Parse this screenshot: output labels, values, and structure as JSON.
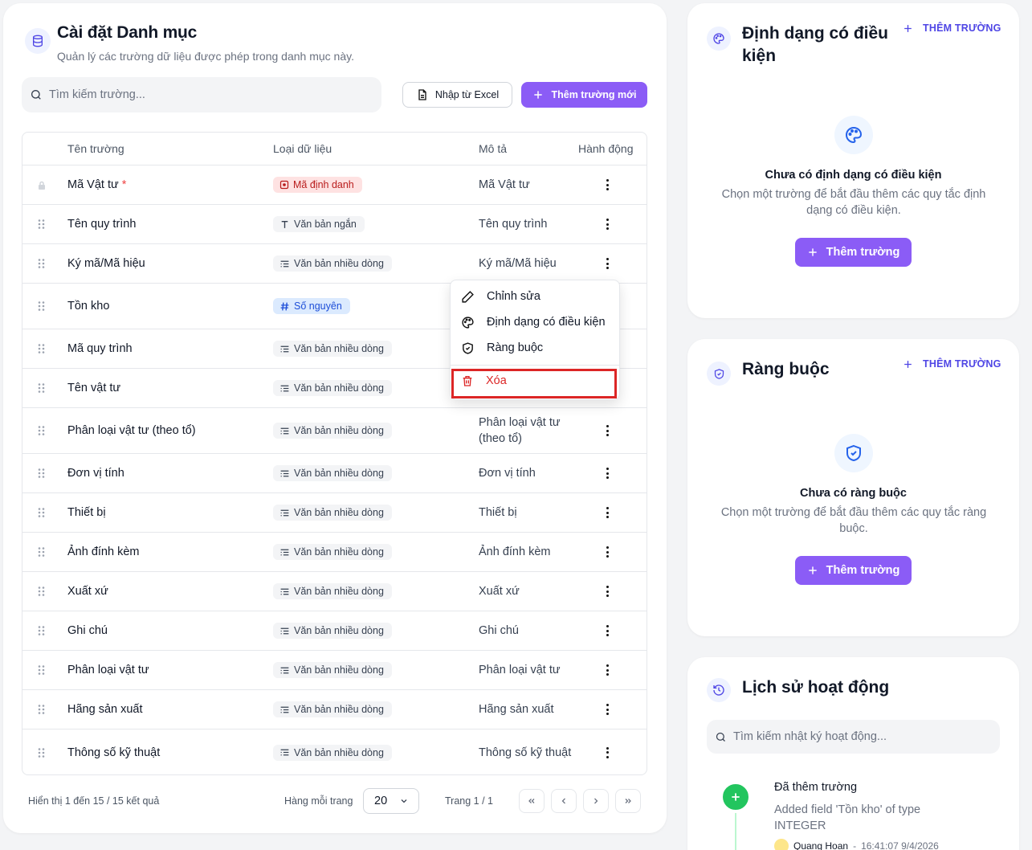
{
  "main": {
    "title": "Cài đặt Danh mục",
    "subtitle": "Quản lý các trường dữ liệu được phép trong danh mục này.",
    "search_placeholder": "Tìm kiếm trường...",
    "import_label": "Nhập từ Excel",
    "add_field_label": "Thêm trường mới",
    "columns": [
      "Tên trường",
      "Loại dữ liệu",
      "Mô tả",
      "Hành động"
    ],
    "rows": [
      {
        "name": "Mã Vật tư",
        "required": "*",
        "type": "Mã định danh",
        "type_icon": "id-badge-icon",
        "desc": "Mã Vật tư",
        "locked": true
      },
      {
        "name": "Tên quy trình",
        "type": "Văn bản ngắn",
        "type_icon": "text-icon",
        "desc": "Tên quy trình"
      },
      {
        "name": "Ký mã/Mã hiệu",
        "type": "Văn bản nhiều dòng",
        "type_icon": "multiline-icon",
        "desc": "Ký mã/Mã hiệu"
      },
      {
        "name": "Tồn kho",
        "type": "Số nguyên",
        "type_icon": "hash-icon",
        "desc": ""
      },
      {
        "name": "Mã quy trình",
        "type": "Văn bản nhiều dòng",
        "type_icon": "multiline-icon",
        "desc": ""
      },
      {
        "name": "Tên vật tư",
        "type": "Văn bản nhiều dòng",
        "type_icon": "multiline-icon",
        "desc": ""
      },
      {
        "name": "Phân loại vật tư (theo tổ)",
        "type": "Văn bản nhiều dòng",
        "type_icon": "multiline-icon",
        "desc": "Phân loại vật tư (theo tổ)"
      },
      {
        "name": "Đơn vị tính",
        "type": "Văn bản nhiều dòng",
        "type_icon": "multiline-icon",
        "desc": "Đơn vị tính"
      },
      {
        "name": "Thiết bị",
        "type": "Văn bản nhiều dòng",
        "type_icon": "multiline-icon",
        "desc": "Thiết bị"
      },
      {
        "name": "Ảnh đính kèm",
        "type": "Văn bản nhiều dòng",
        "type_icon": "multiline-icon",
        "desc": "Ảnh đính kèm"
      },
      {
        "name": "Xuất xứ",
        "type": "Văn bản nhiều dòng",
        "type_icon": "multiline-icon",
        "desc": "Xuất xứ"
      },
      {
        "name": "Ghi chú",
        "type": "Văn bản nhiều dòng",
        "type_icon": "multiline-icon",
        "desc": "Ghi chú"
      },
      {
        "name": "Phân loại vật tư",
        "type": "Văn bản nhiều dòng",
        "type_icon": "multiline-icon",
        "desc": "Phân loại vật tư"
      },
      {
        "name": "Hãng sản xuất",
        "type": "Văn bản nhiều dòng",
        "type_icon": "multiline-icon",
        "desc": "Hãng sản xuất"
      },
      {
        "name": "Thông số kỹ thuật",
        "type": "Văn bản nhiều dòng",
        "type_icon": "multiline-icon",
        "desc": "Thông số kỹ thuật"
      }
    ],
    "footer": {
      "showing": "Hiển thị 1 đến 15 / 15 kết quả",
      "rows_per_page_label": "Hàng mỗi trang",
      "rows_per_page": "20",
      "page_info": "Trang 1 / 1"
    }
  },
  "context_menu": {
    "items": [
      {
        "label": "Chỉnh sửa",
        "icon": "pencil-icon"
      },
      {
        "label": "Định dạng có điều kiện",
        "icon": "palette-icon"
      },
      {
        "label": "Ràng buộc",
        "icon": "shield-icon"
      },
      {
        "label": "Xóa",
        "icon": "trash-icon"
      }
    ]
  },
  "conditional_format": {
    "title": "Định dạng có điều kiện",
    "add_link": "THÊM TRƯỜNG",
    "empty_title": "Chưa có định dạng có điều kiện",
    "empty_desc": "Chọn một trường để bắt đầu thêm các quy tắc định dạng có điều kiện.",
    "button": "Thêm trường"
  },
  "constraints": {
    "title": "Ràng buộc",
    "add_link": "THÊM TRƯỜNG",
    "empty_title": "Chưa có ràng buộc",
    "empty_desc": "Chọn một trường để bắt đầu thêm các quy tắc ràng buộc.",
    "button": "Thêm trường"
  },
  "activity": {
    "title": "Lịch sử hoạt động",
    "search_placeholder": "Tìm kiếm nhật ký hoạt động...",
    "entry": {
      "title": "Đã thêm trường",
      "detail": "Added field 'Tồn kho' of type INTEGER",
      "user": "Quang Hoan",
      "separator": "-",
      "time": "16:41:07 9/4/2026"
    }
  },
  "colors": {
    "primary": "#8b5cf6",
    "link": "#4f46e5",
    "danger": "#dc2626",
    "success": "#22c55e"
  }
}
